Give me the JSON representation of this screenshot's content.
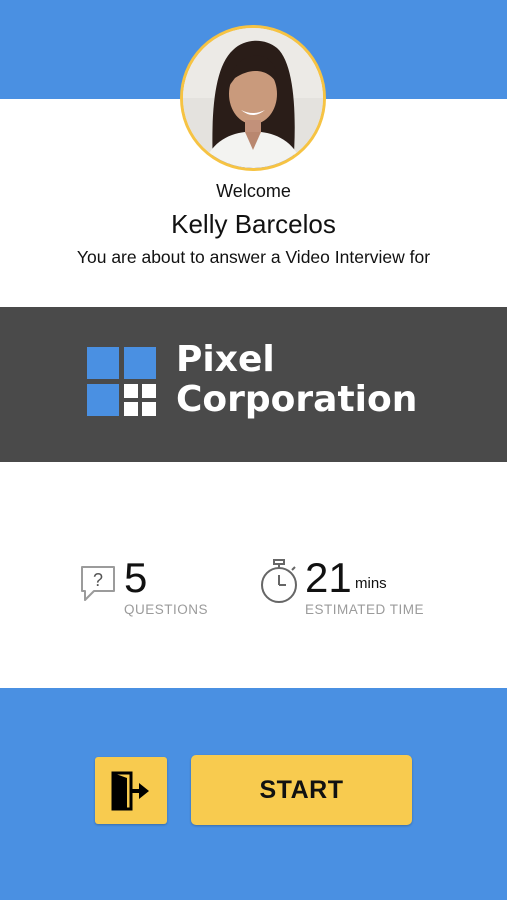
{
  "header": {
    "welcome": "Welcome",
    "candidate_name": "Kelly Barcelos",
    "intro": "You are about to answer a Video Interview for"
  },
  "company": {
    "name_line1": "Pixel",
    "name_line2": "Corporation",
    "logo_icon": "four-squares-logo"
  },
  "stats": {
    "questions": {
      "value": "5",
      "label": "QUESTIONS",
      "icon": "question-bubble-icon"
    },
    "time": {
      "value": "21",
      "unit": "mins",
      "label": "ESTIMATED TIME",
      "icon": "stopwatch-icon"
    }
  },
  "actions": {
    "exit_icon": "exit-door-icon",
    "start_label": "START"
  },
  "colors": {
    "primary_blue": "#4A90E2",
    "band_dark": "#4A4A4A",
    "button_yellow": "#F8CB4F",
    "avatar_border": "#F6C343",
    "label_gray": "#9B9B9B"
  }
}
